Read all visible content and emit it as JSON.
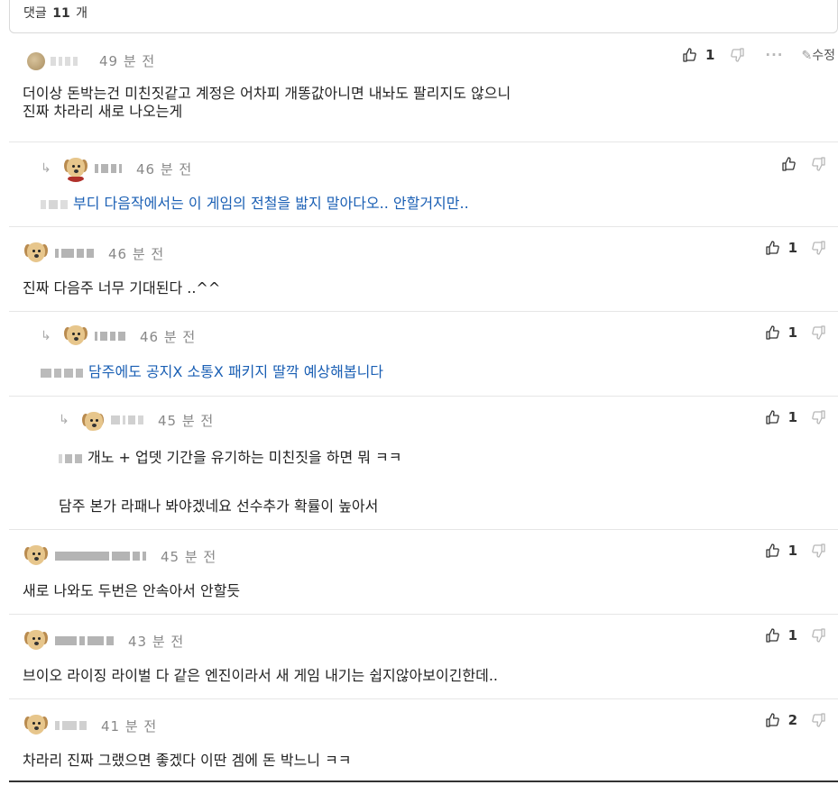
{
  "header": {
    "prefix": "댓글",
    "count": "11",
    "suffix": "개"
  },
  "comments": [
    {
      "time": "49 분 전",
      "text_line1": "더이상 돈박는건 미친짓같고 계정은 어차피 개똥값아니면 내놔도 팔리지도 않으니",
      "text_line2": "진짜 차라리 새로 나오는게",
      "likes": "1",
      "edit_label": "수정"
    },
    {
      "time": "46 분 전",
      "text": "부디 다음작에서는 이 게임의 전철을 밟지 말아다오.. 안할거지만..",
      "likes": ""
    },
    {
      "time": "46 분 전",
      "text": "진짜 다음주 너무 기대된다 ..^^",
      "likes": "1"
    },
    {
      "time": "46 분 전",
      "text": "담주에도 공지X 소통X 패키지 딸깍 예상해봅니다",
      "likes": "1"
    },
    {
      "time": "45 분 전",
      "text_line1": "개노 + 업뎃 기간을 유기하는 미친짓을 하면 뭐 ㅋㅋ",
      "text_line2": "담주 본가 라패나 봐야겠네요 선수추가 확률이 높아서",
      "likes": "1"
    },
    {
      "time": "45 분 전",
      "text": "새로 나와도 두번은 안속아서 안할듯",
      "likes": "1"
    },
    {
      "time": "43 분 전",
      "text": "브이오 라이징 라이벌 다 같은 엔진이라서 새 게임 내기는 쉽지않아보이긴한데..",
      "likes": "1"
    },
    {
      "time": "41 분 전",
      "text": "차라리 진짜 그랬으면 좋겠다 이딴 겜에 돈 박느니 ㅋㅋ",
      "likes": "2"
    }
  ],
  "icons": {
    "like": "thumbs-up-icon",
    "dislike": "thumbs-down-icon",
    "more": "more-dots-icon",
    "edit": "pencil-icon",
    "reply": "reply-arrow-icon"
  },
  "colors": {
    "mention_text": "#1a5fb4"
  }
}
